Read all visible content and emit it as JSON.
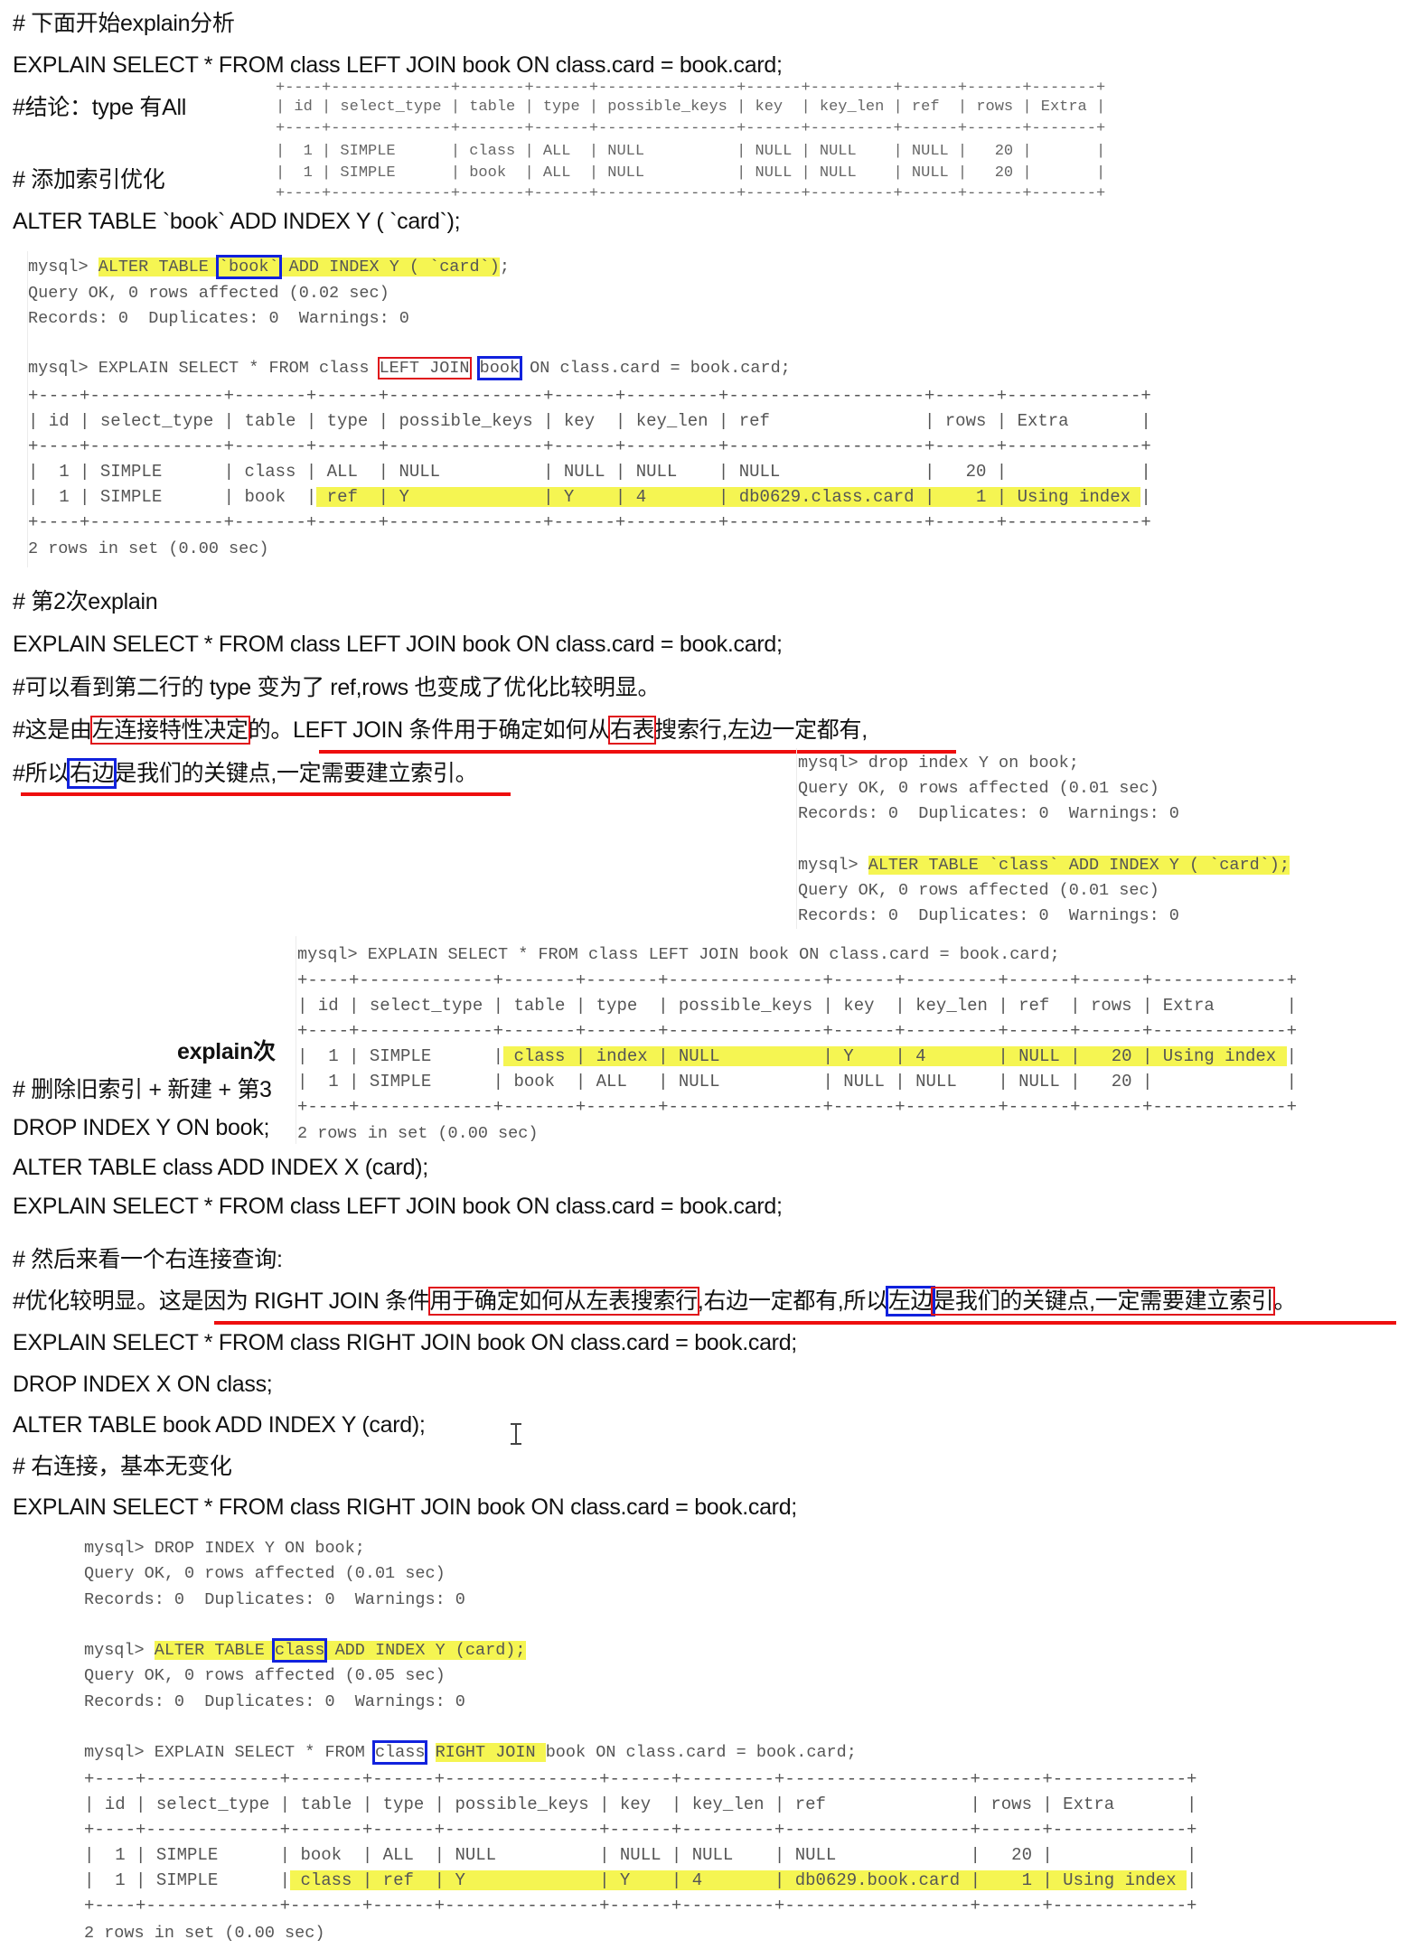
{
  "section1": {
    "heading": "# 下面开始explain分析",
    "query": "EXPLAIN SELECT * FROM class LEFT JOIN book ON class.card = book.card;",
    "conclusion": "#结论：type 有All",
    "add_index_heading": "# 添加索引优化",
    "alter": "ALTER TABLE `book` ADD INDEX Y ( `card`);",
    "table": {
      "border": "+----+-------------+-------+------+---------------+------+---------+------+------+-------+",
      "header": "| id | select_type | table | type | possible_keys | key  | key_len | ref  | rows | Extra |",
      "rows": [
        "|  1 | SIMPLE      | class | ALL  | NULL          | NULL | NULL    | NULL |   20 |       |",
        "|  1 | SIMPLE      | book  | ALL  | NULL          | NULL | NULL    | NULL |   20 |       |"
      ]
    }
  },
  "console1": {
    "prompt": "mysql> ",
    "alter_a": "ALTER TABLE ",
    "alter_b": "`book`",
    "alter_c": " ADD INDEX Y ( `card`)",
    "alter_d": ";",
    "ok": "Query OK, 0 rows affected (0.02 sec)",
    "records": "Records: 0  Duplicates: 0  Warnings: 0",
    "explain_a": "EXPLAIN SELECT * FROM class ",
    "explain_b": "LEFT JOIN",
    "explain_c": " ",
    "explain_d": "book",
    "explain_e": " ON class.card = book.card;",
    "table": {
      "border": "+----+-------------+-------+------+---------------+------+---------+-------------------+------+-------------+",
      "header": "| id | select_type | table | type | possible_keys | key  | key_len | ref               | rows | Extra       |",
      "row1": "|  1 | SIMPLE      | class | ALL  | NULL          | NULL | NULL    | NULL              |   20 |             |",
      "row2_a": "|  1 | SIMPLE      | book  |",
      "row2_b": " ref  | Y             | Y    | 4       | db0629.class.card |    1 | Using index ",
      "row2_c": "|"
    },
    "summary": "2 rows in set (0.00 sec)"
  },
  "section2": {
    "heading": "# 第2次explain",
    "query": "EXPLAIN SELECT * FROM class LEFT JOIN book ON class.card = book.card;",
    "note1": "#可以看到第二行的 type 变为了 ref,rows 也变成了优化比较明显。",
    "note2_a": "#这是由",
    "note2_b": "左连接特性决定",
    "note2_c": "的。",
    "note2_d": "LEFT JOIN 条件用于确定如何从",
    "note2_e": "右表",
    "note2_f": "搜索行,左边一定都有,",
    "note3_a": "#所以",
    "note3_b": "右边",
    "note3_c": "是我们的关键点,一定需要建立索引。"
  },
  "console2": {
    "drop": "mysql> drop index Y on book;",
    "ok1": "Query OK, 0 rows affected (0.01 sec)",
    "records1": "Records: 0  Duplicates: 0  Warnings: 0",
    "prompt": "mysql> ",
    "alter": "ALTER TABLE `class` ADD INDEX Y ( `card`);",
    "ok2": "Query OK, 0 rows affected (0.01 sec)",
    "records2": "Records: 0  Duplicates: 0  Warnings: 0"
  },
  "console3": {
    "explain": "mysql> EXPLAIN SELECT * FROM class LEFT JOIN book ON class.card = book.card;",
    "table": {
      "border": "+----+-------------+-------+-------+---------------+------+---------+------+------+-------------+",
      "header": "| id | select_type | table | type  | possible_keys | key  | key_len | ref  | rows | Extra       |",
      "row1_a": "|  1 | SIMPLE      |",
      "row1_b": " class | index | NULL          | Y    | 4       | NULL |   20 | Using index ",
      "row1_c": "|",
      "row2": "|  1 | SIMPLE      | book  | ALL   | NULL          | NULL | NULL    | NULL |   20 |             |"
    },
    "summary": "2 rows in set (0.00 sec)"
  },
  "section3": {
    "overlay": "explain次",
    "heading": "# 删除旧索引 + 新建 + 第3",
    "drop": "DROP INDEX Y ON book;",
    "alter": "ALTER TABLE class ADD INDEX X (card);",
    "query": "EXPLAIN SELECT * FROM class LEFT JOIN book ON class.card = book.card;"
  },
  "section4": {
    "heading": "# 然后来看一个右连接查询:",
    "note_a": "#优化较明显。这是因为 RIGHT JOIN 条件",
    "note_b": "用于确定如何从左表搜索行",
    "note_c": ",右边一定都有,所以",
    "note_d": "左边",
    "note_e": "是我们的关键点,一定需要建立索引",
    "note_f": "。",
    "query1": "EXPLAIN SELECT * FROM class RIGHT JOIN book ON class.card = book.card;",
    "drop": "DROP INDEX X ON class;",
    "alter": "ALTER TABLE book ADD INDEX Y (card);",
    "heading2": "# 右连接，基本无变化",
    "query2": "EXPLAIN SELECT * FROM class RIGHT JOIN book ON class.card = book.card;"
  },
  "console4": {
    "drop": "mysql> DROP INDEX Y ON book;",
    "ok1": "Query OK, 0 rows affected (0.01 sec)",
    "records1": "Records: 0  Duplicates: 0  Warnings: 0",
    "prompt": "mysql> ",
    "alter_a": "ALTER TABLE ",
    "alter_b": "class",
    "alter_c": " ADD INDEX Y (card);",
    "ok2": "Query OK, 0 rows affected (0.05 sec)",
    "records2": "Records: 0  Duplicates: 0  Warnings: 0",
    "explain_a": "mysql> EXPLAIN SELECT * FROM ",
    "explain_b": "class",
    "explain_c": " ",
    "explain_d": "RIGHT JOIN ",
    "explain_e": "book ON class.card = book.card;",
    "table": {
      "border": "+----+-------------+-------+------+---------------+------+---------+------------------+------+-------------+",
      "header": "| id | select_type | table | type | possible_keys | key  | key_len | ref              | rows | Extra       |",
      "row1": "|  1 | SIMPLE      | book  | ALL  | NULL          | NULL | NULL    | NULL             |   20 |             |",
      "row2_a": "|  1 | SIMPLE      |",
      "row2_b": " class | ref  | Y             | Y    | 4       | db0629.book.card |    1 | Using index ",
      "row2_c": "|"
    },
    "summary": "2 rows in set (0.00 sec)"
  },
  "colors": {
    "highlight": "#f5f552",
    "red_annotation": "#e0141a",
    "blue_annotation": "#1122dd",
    "console_text": "#555555"
  }
}
